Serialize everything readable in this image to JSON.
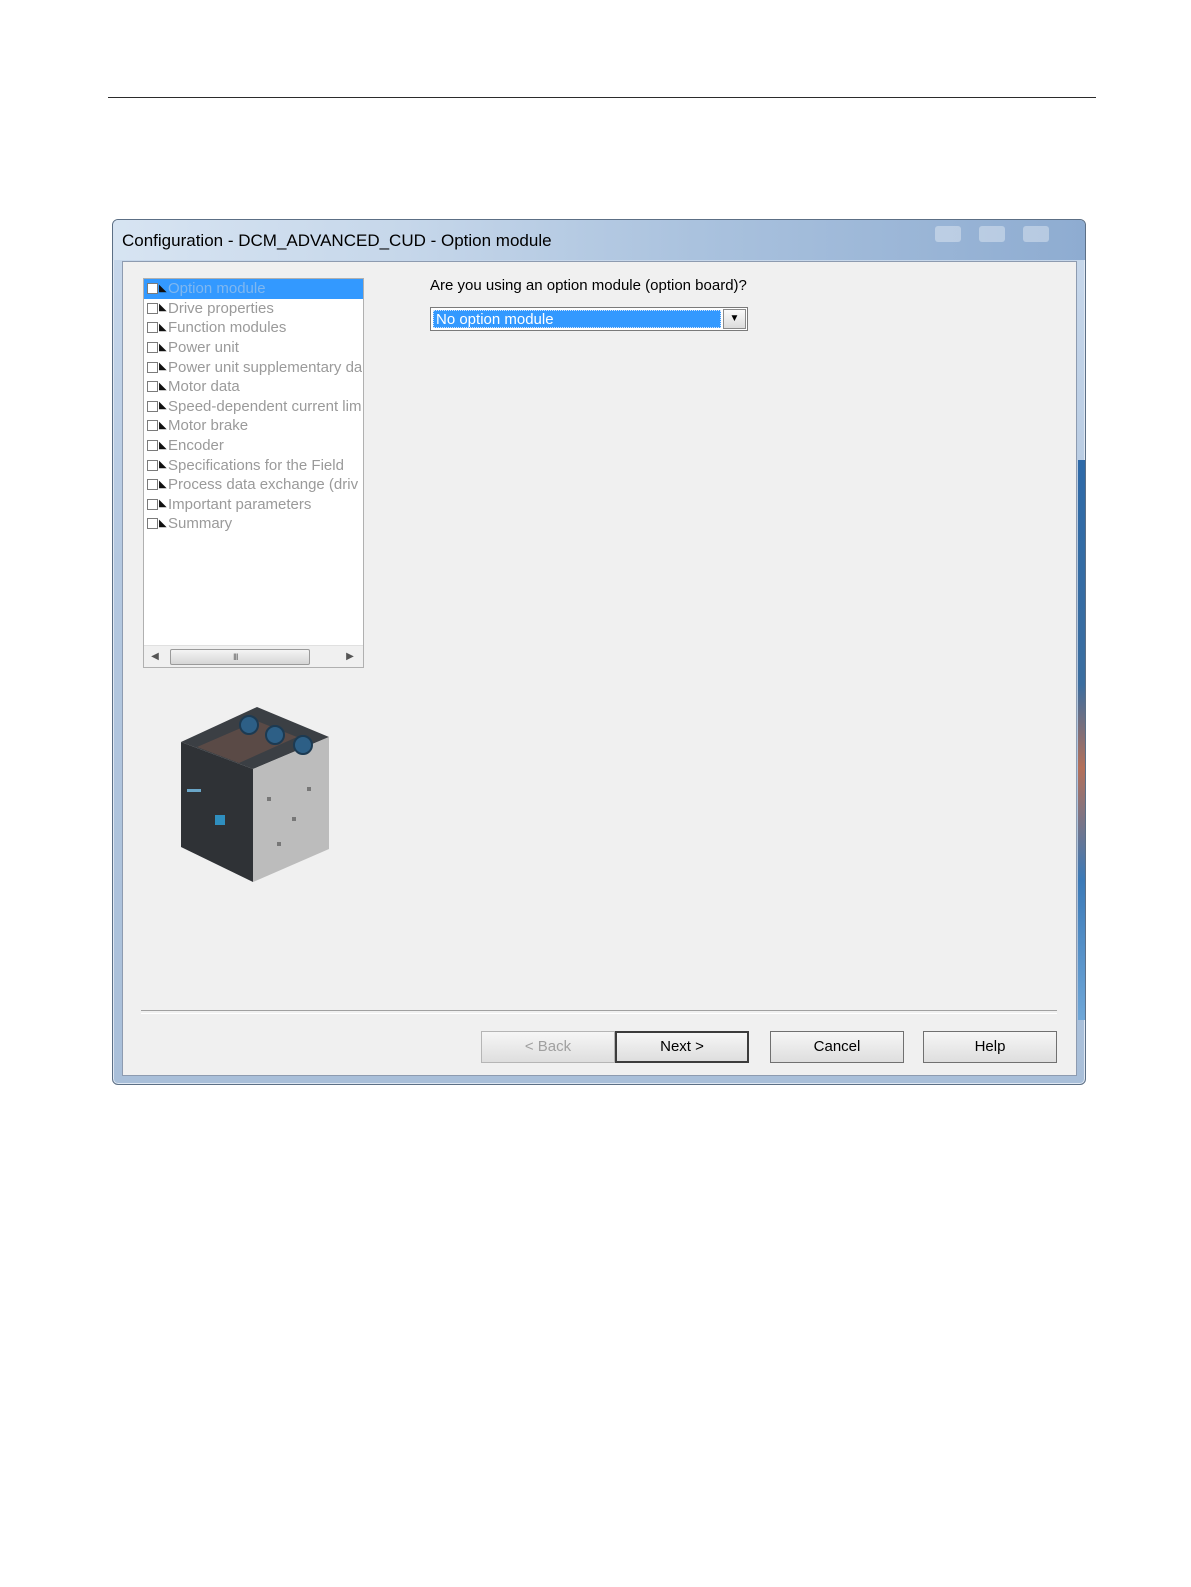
{
  "window": {
    "title": "Configuration - DCM_ADVANCED_CUD - Option module"
  },
  "tree": {
    "items": [
      {
        "label": "Option module",
        "selected": true
      },
      {
        "label": "Drive properties"
      },
      {
        "label": "Function modules"
      },
      {
        "label": "Power unit"
      },
      {
        "label": "Power unit supplementary da"
      },
      {
        "label": "Motor data"
      },
      {
        "label": "Speed-dependent current lim"
      },
      {
        "label": "Motor brake"
      },
      {
        "label": "Encoder"
      },
      {
        "label": "Specifications for the Field"
      },
      {
        "label": "Process data exchange (driv"
      },
      {
        "label": "Important parameters"
      },
      {
        "label": "Summary"
      }
    ],
    "scroll_grip": "III"
  },
  "main": {
    "question": "Are you using an option module (option board)?",
    "combo_value": "No option module"
  },
  "buttons": {
    "back": "< Back",
    "next": "Next >",
    "cancel": "Cancel",
    "help": "Help"
  },
  "colors": {
    "selection": "#3399ff",
    "dialog_bg": "#f0f0f0"
  }
}
